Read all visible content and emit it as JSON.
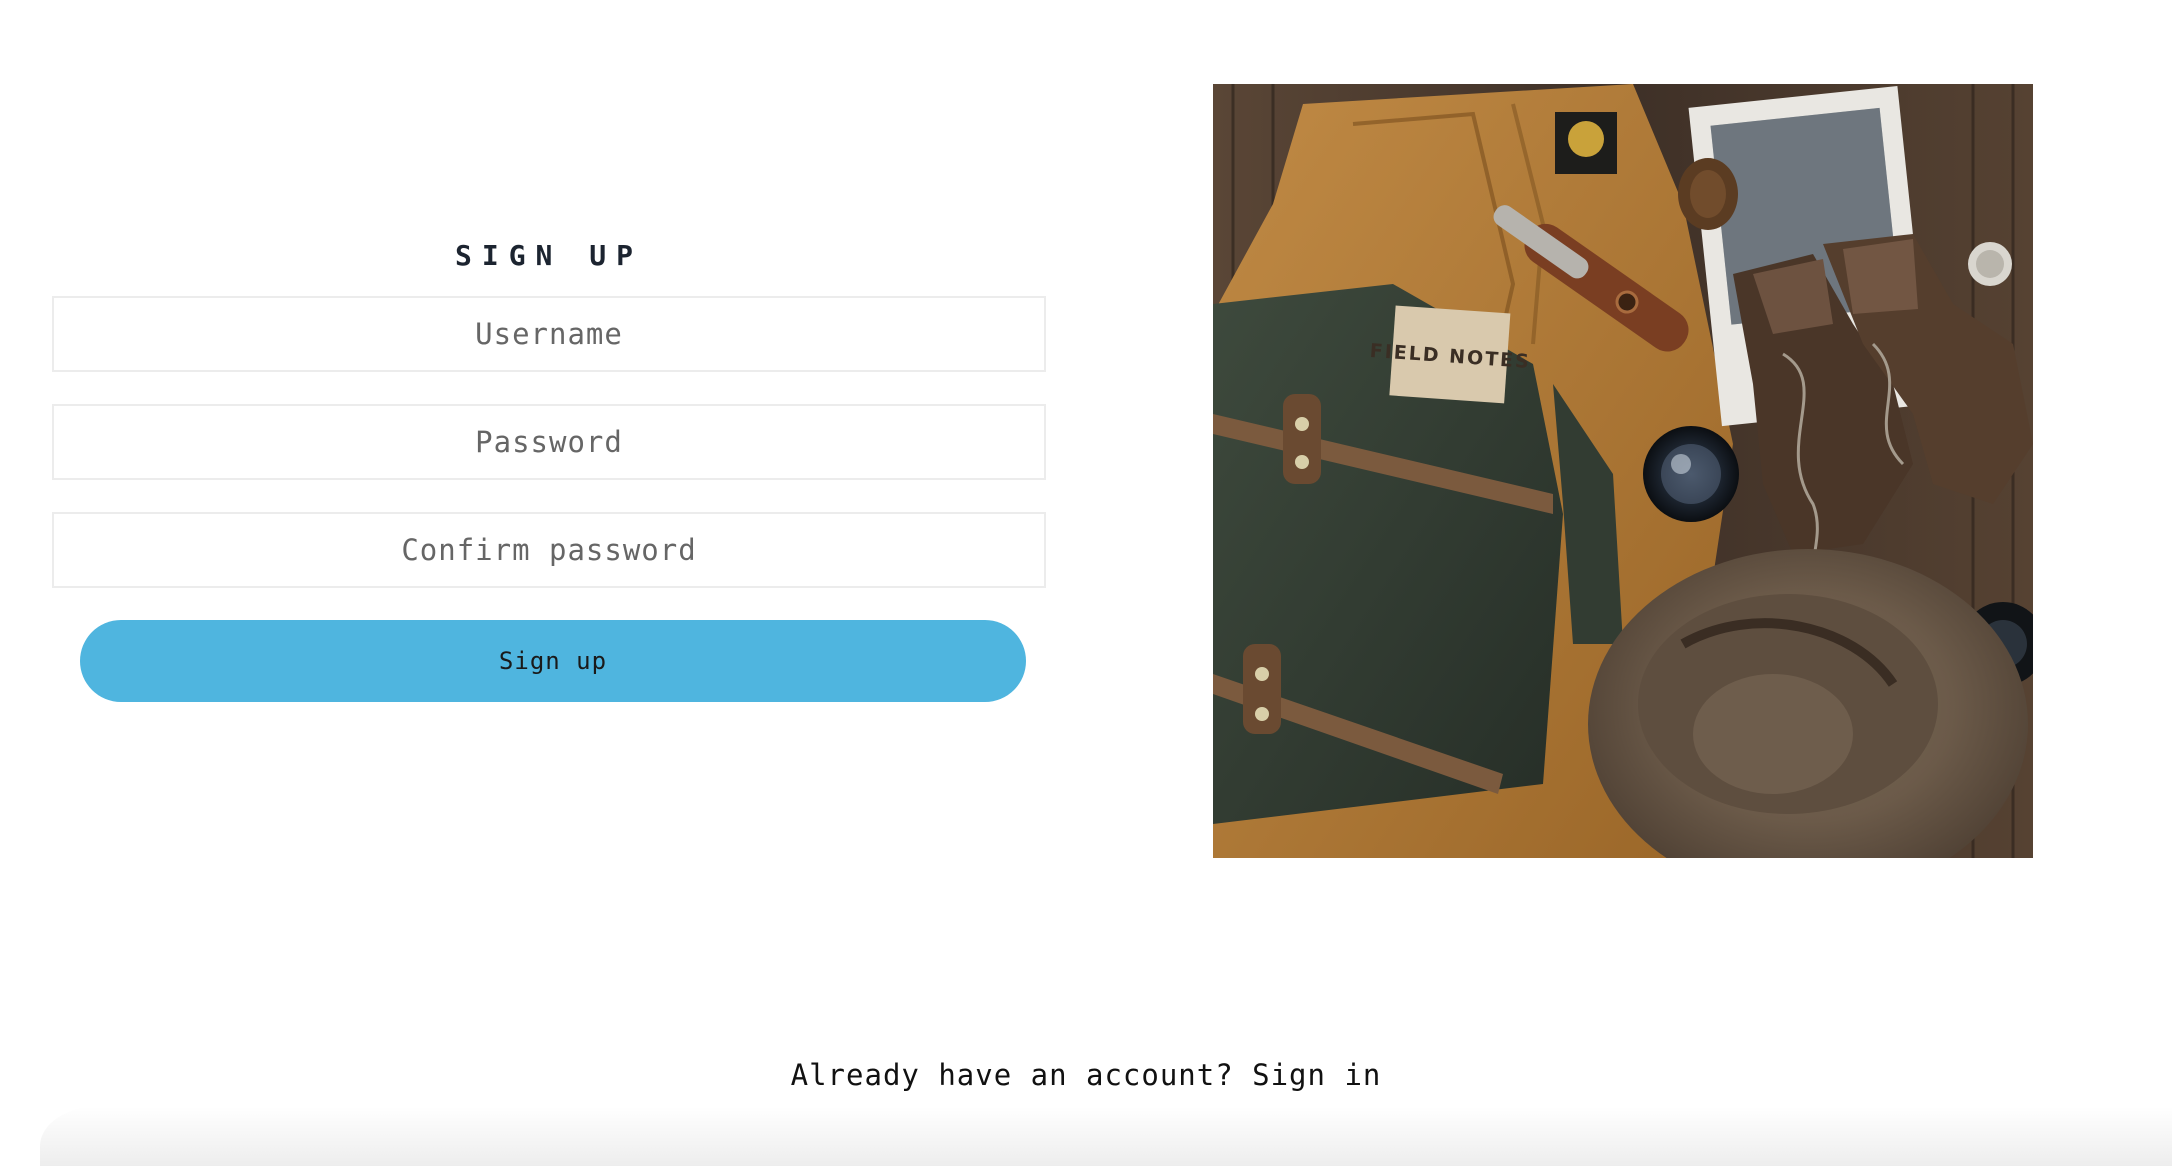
{
  "signup": {
    "title": "SIGN UP",
    "username_placeholder": "Username",
    "password_placeholder": "Password",
    "confirm_placeholder": "Confirm password",
    "submit_label": "Sign up"
  },
  "photo": {
    "notebook_text": "FIELD NOTES"
  },
  "footer": {
    "prompt": "Already have an account?",
    "signin_label": "Sign in"
  },
  "colors": {
    "accent": "#4fb5df",
    "title": "#1c2430",
    "field_border": "#ececec"
  }
}
